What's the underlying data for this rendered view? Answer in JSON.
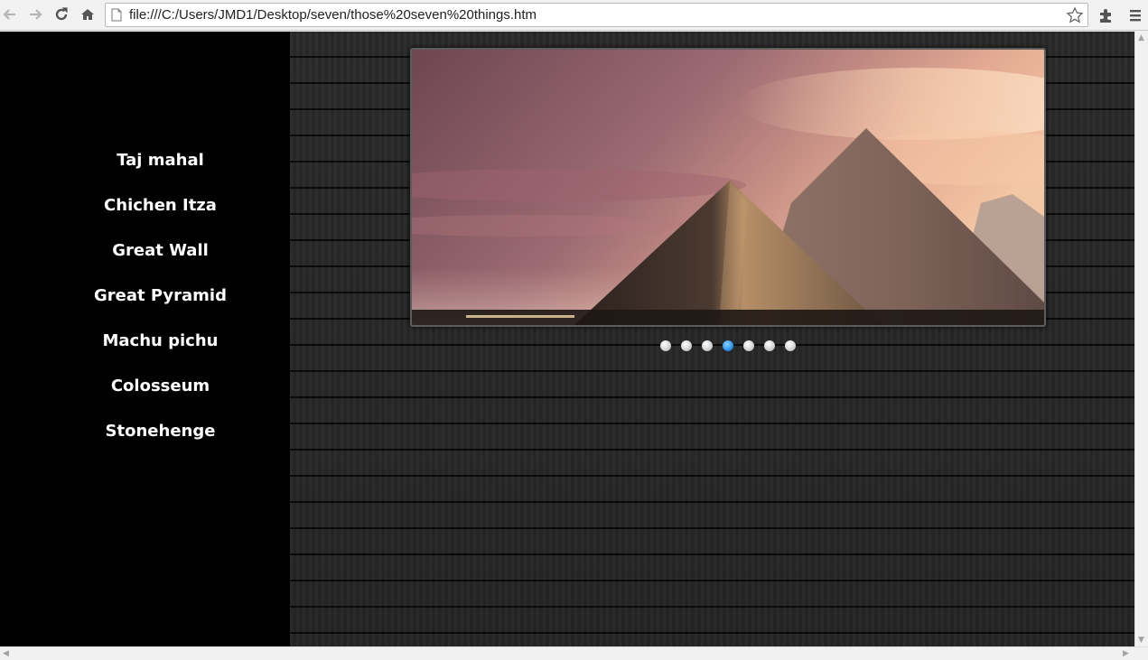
{
  "browser": {
    "url": "file:///C:/Users/JMD1/Desktop/seven/those%20seven%20things.htm",
    "icons": [
      "back-icon",
      "forward-icon",
      "reload-icon",
      "home-icon",
      "page-icon",
      "star-icon",
      "extensions-icon",
      "menu-icon"
    ]
  },
  "sidebar": {
    "items": [
      {
        "label": "Taj mahal"
      },
      {
        "label": "Chichen Itza"
      },
      {
        "label": "Great Wall"
      },
      {
        "label": "Great Pyramid"
      },
      {
        "label": "Machu pichu"
      },
      {
        "label": "Colosseum"
      },
      {
        "label": "Stonehenge"
      }
    ]
  },
  "slider": {
    "dot_count": 7,
    "active_index": 3,
    "accent": "#2b93e8"
  }
}
